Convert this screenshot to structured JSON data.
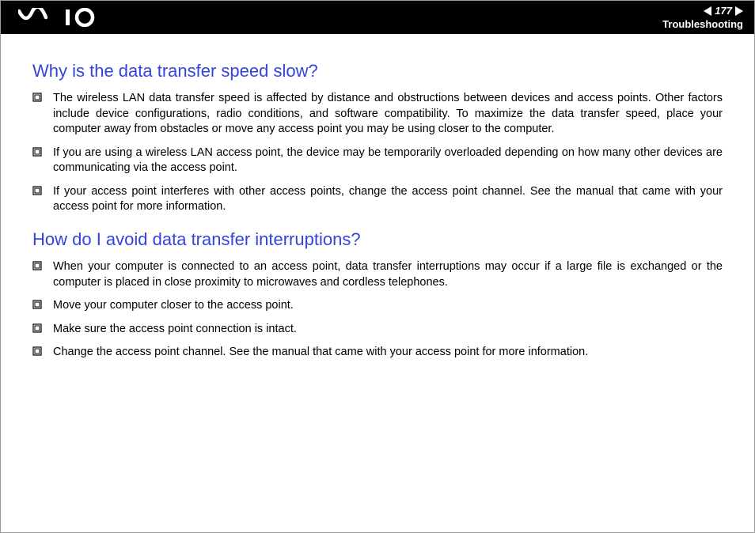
{
  "header": {
    "page_number": "177",
    "section": "Troubleshooting"
  },
  "sections": [
    {
      "heading": "Why is the data transfer speed slow?",
      "items": [
        "The wireless LAN data transfer speed is affected by distance and obstructions between devices and access points. Other factors include device configurations, radio conditions, and software compatibility. To maximize the data transfer speed, place your computer away from obstacles or move any access point you may be using closer to the computer.",
        "If you are using a wireless LAN access point, the device may be temporarily overloaded depending on how many other devices are communicating via the access point.",
        "If your access point interferes with other access points, change the access point channel. See the manual that came with your access point for more information."
      ]
    },
    {
      "heading": "How do I avoid data transfer interruptions?",
      "items": [
        "When your computer is connected to an access point, data transfer interruptions may occur if a large file is exchanged or the computer is placed in close proximity to microwaves and cordless telephones.",
        "Move your computer closer to the access point.",
        "Make sure the access point connection is intact.",
        "Change the access point channel. See the manual that came with your access point for more information."
      ]
    }
  ]
}
